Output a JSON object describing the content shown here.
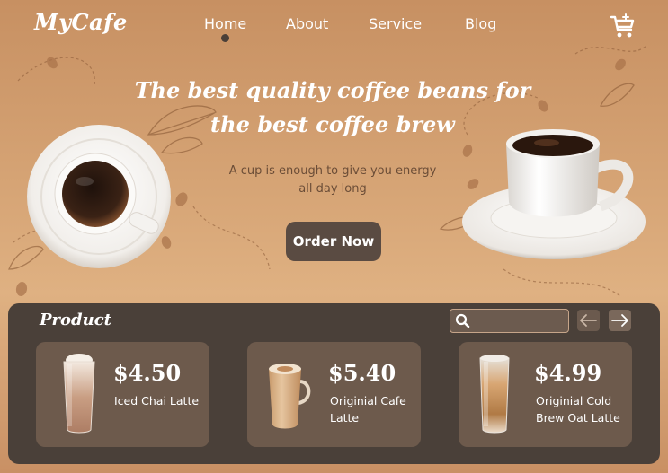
{
  "header": {
    "logo": "MyCafe",
    "nav": [
      {
        "label": "Home",
        "active": true
      },
      {
        "label": "About",
        "active": false
      },
      {
        "label": "Service",
        "active": false
      },
      {
        "label": "Blog",
        "active": false
      }
    ],
    "cart_icon": "cart-plus-icon"
  },
  "hero": {
    "title_line1": "The best quality coffee beans for",
    "title_line2": "the best coffee brew",
    "subtitle_line1": "A cup is enough to give you energy",
    "subtitle_line2": "all day long",
    "cta_label": "Order Now"
  },
  "products": {
    "title": "Product",
    "search": {
      "placeholder": "",
      "value": "",
      "icon": "search-icon"
    },
    "prev_icon": "arrow-left-icon",
    "next_icon": "arrow-right-icon",
    "items": [
      {
        "price": "$4.50",
        "name_line1": "Iced Chai Latte",
        "name_line2": ""
      },
      {
        "price": "$5.40",
        "name_line1": "Originial Cafe",
        "name_line2": "Latte"
      },
      {
        "price": "$4.99",
        "name_line1": "Originial Cold",
        "name_line2": "Brew Oat Latte"
      }
    ]
  },
  "colors": {
    "background": "#d8a778",
    "panel": "#4a4039",
    "card": "#6d5a4c",
    "button": "#5a4b42",
    "text_light": "#ffffff",
    "text_brown": "#6b4d37"
  }
}
